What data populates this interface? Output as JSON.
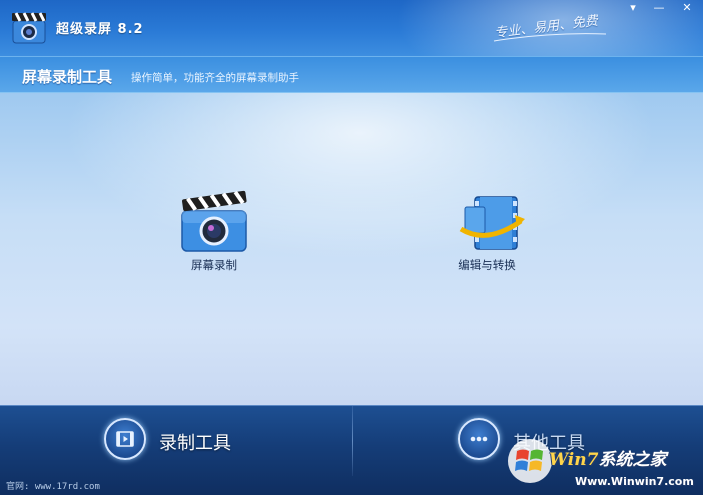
{
  "window": {
    "title": "超级录屏 8.2",
    "slogan": "专业、易用、免费",
    "buttons": {
      "menu": "▾",
      "minimize": "—",
      "close": "✕"
    }
  },
  "header": {
    "title": "屏幕录制工具",
    "subtitle": "操作简单，功能齐全的屏幕录制助手"
  },
  "tools": [
    {
      "label": "屏幕录制",
      "icon": "clapperboard-camera-icon"
    },
    {
      "label": "编辑与转换",
      "icon": "film-convert-icon"
    }
  ],
  "bottom_nav": [
    {
      "label": "录制工具",
      "icon": "film-icon",
      "active": true
    },
    {
      "label": "其他工具",
      "icon": "more-dots-icon",
      "active": false
    }
  ],
  "footer": {
    "website": "官网: www.17rd.com"
  },
  "watermark": {
    "title_prefix": "Win7",
    "title_suffix": "系统之家",
    "url": "Www.Winwin7.com"
  },
  "colors": {
    "titlebar": "#1e67c6",
    "header": "#4a9be5",
    "bottombar": "#153d78",
    "accent": "#ffd54a"
  }
}
